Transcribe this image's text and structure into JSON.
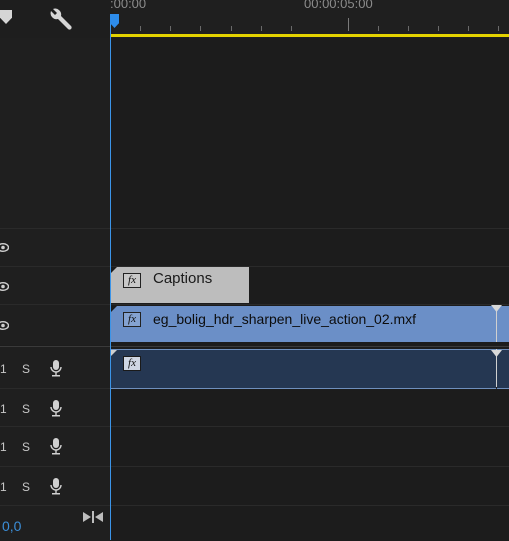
{
  "ruler": {
    "time_start": ":00:00",
    "time_mid": "00:00:05:00"
  },
  "header": {
    "icons": [
      "marker-shield-icon",
      "wrench-icon"
    ]
  },
  "tracks": {
    "video": [
      {
        "id": "v3",
        "icon": "eye-icon"
      },
      {
        "id": "v2",
        "icon": "eye-icon"
      },
      {
        "id": "v1",
        "icon": "eye-icon"
      }
    ],
    "audio": [
      {
        "num": "1",
        "solo": "S",
        "icon": "mic-icon"
      },
      {
        "num": "1",
        "solo": "S",
        "icon": "mic-icon"
      },
      {
        "num": "1",
        "solo": "S",
        "icon": "mic-icon"
      },
      {
        "num": "1",
        "solo": "S",
        "icon": "mic-icon"
      }
    ]
  },
  "clips": {
    "captions": {
      "fx": "fx",
      "label": "Captions"
    },
    "video": {
      "fx": "fx",
      "label": "eg_bolig_hdr_sharpen_live_action_02.mxf"
    },
    "audio": {
      "fx": "fx"
    }
  },
  "footer": {
    "zoom_readout": "0,0",
    "icon": "fit-to-sequence-icon"
  },
  "colors": {
    "background": "#1d1d1d",
    "playhead": "#2d8ceb",
    "work_area": "#e3d200",
    "video_clip": "#6b8fc7",
    "audio_clip": "#253752",
    "captions_clip": "#bdbdbd"
  }
}
